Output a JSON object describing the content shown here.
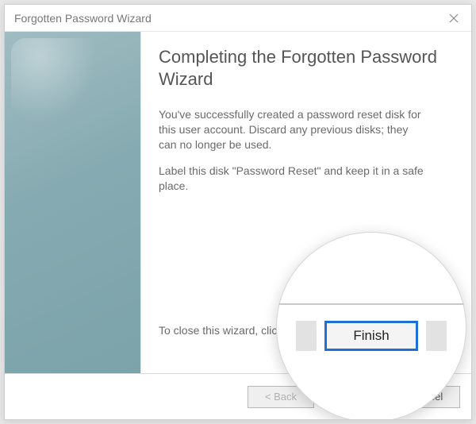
{
  "window": {
    "title": "Forgotten Password Wizard"
  },
  "content": {
    "heading": "Completing the Forgotten Password Wizard",
    "para1": "You've successfully created a password reset disk for this user account. Discard any previous disks; they can no longer be used.",
    "para2": "Label this disk \"Password Reset\" and keep it in a safe place.",
    "close_hint": "To close this wizard, click Finish."
  },
  "footer": {
    "back": "< Back",
    "finish": "Finish",
    "cancel": "Cancel"
  },
  "magnifier": {
    "finish": "Finish"
  }
}
